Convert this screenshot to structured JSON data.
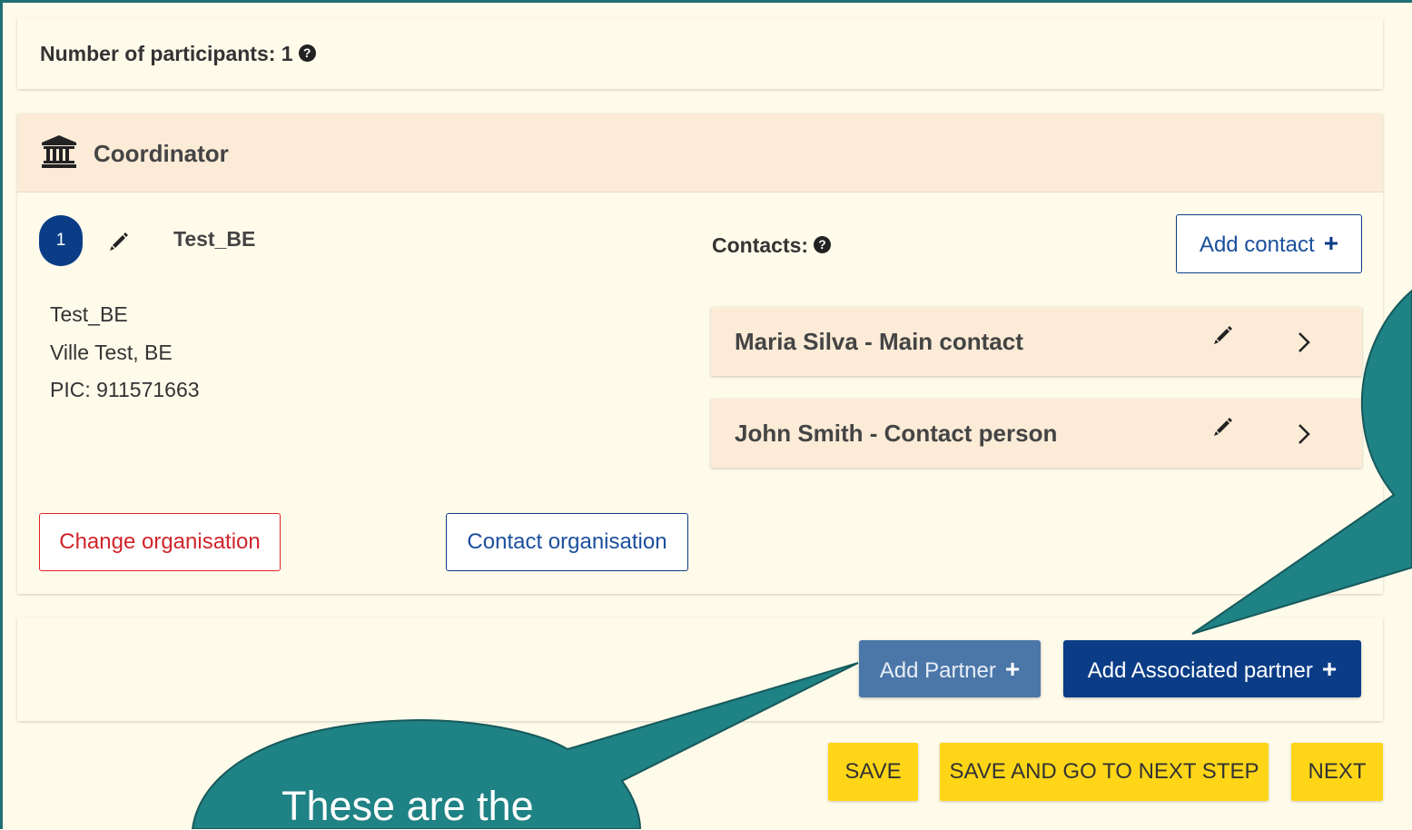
{
  "participants": {
    "label": "Number of participants: 1",
    "help_icon": "question-circle-icon"
  },
  "coordinator": {
    "title": "Coordinator",
    "icon": "bank-icon",
    "number": "1",
    "org_name": "Test_BE",
    "address": [
      "Test_BE",
      "Ville Test, BE",
      "PIC: 911571663"
    ],
    "contacts_label": "Contacts:",
    "add_contact_label": "Add contact",
    "contacts": [
      {
        "name": "Maria Silva - Main contact"
      },
      {
        "name": "John Smith - Contact person"
      }
    ],
    "change_org_label": "Change organisation",
    "contact_org_label": "Contact organisation"
  },
  "partners": {
    "add_partner_label": "Add Partner",
    "add_associated_label": "Add Associated partner"
  },
  "footer": {
    "save_label": "SAVE",
    "save_next_label": "SAVE AND GO TO NEXT STEP",
    "next_label": "NEXT"
  },
  "callout": {
    "text": "These are the"
  },
  "colors": {
    "background": "#fffbeb",
    "header_bg": "#fbebd7",
    "primary": "#0b3d87",
    "partner_btn": "#4b76a8",
    "danger": "#d0252b",
    "yellow": "#ffd617",
    "callout": "#1f8284"
  }
}
